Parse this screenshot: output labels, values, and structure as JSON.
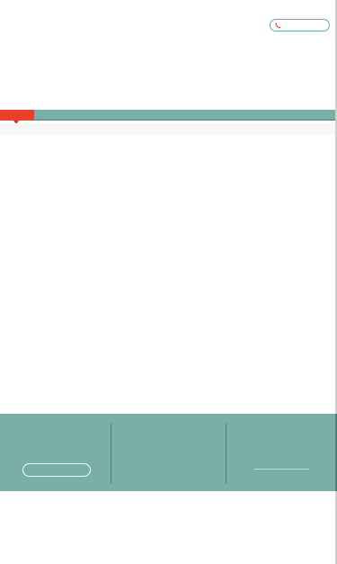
{
  "header": {
    "phone_button": {
      "label": "",
      "icon": "phone-icon",
      "icon_color": "#e8402a",
      "border_color": "#6aa9a1"
    }
  },
  "nav": {
    "background_color": "#7aafa7",
    "active_color": "#e8402a",
    "active_item": {
      "label": ""
    }
  },
  "footer": {
    "background_color": "#7aafa7",
    "button": {
      "label": ""
    }
  }
}
